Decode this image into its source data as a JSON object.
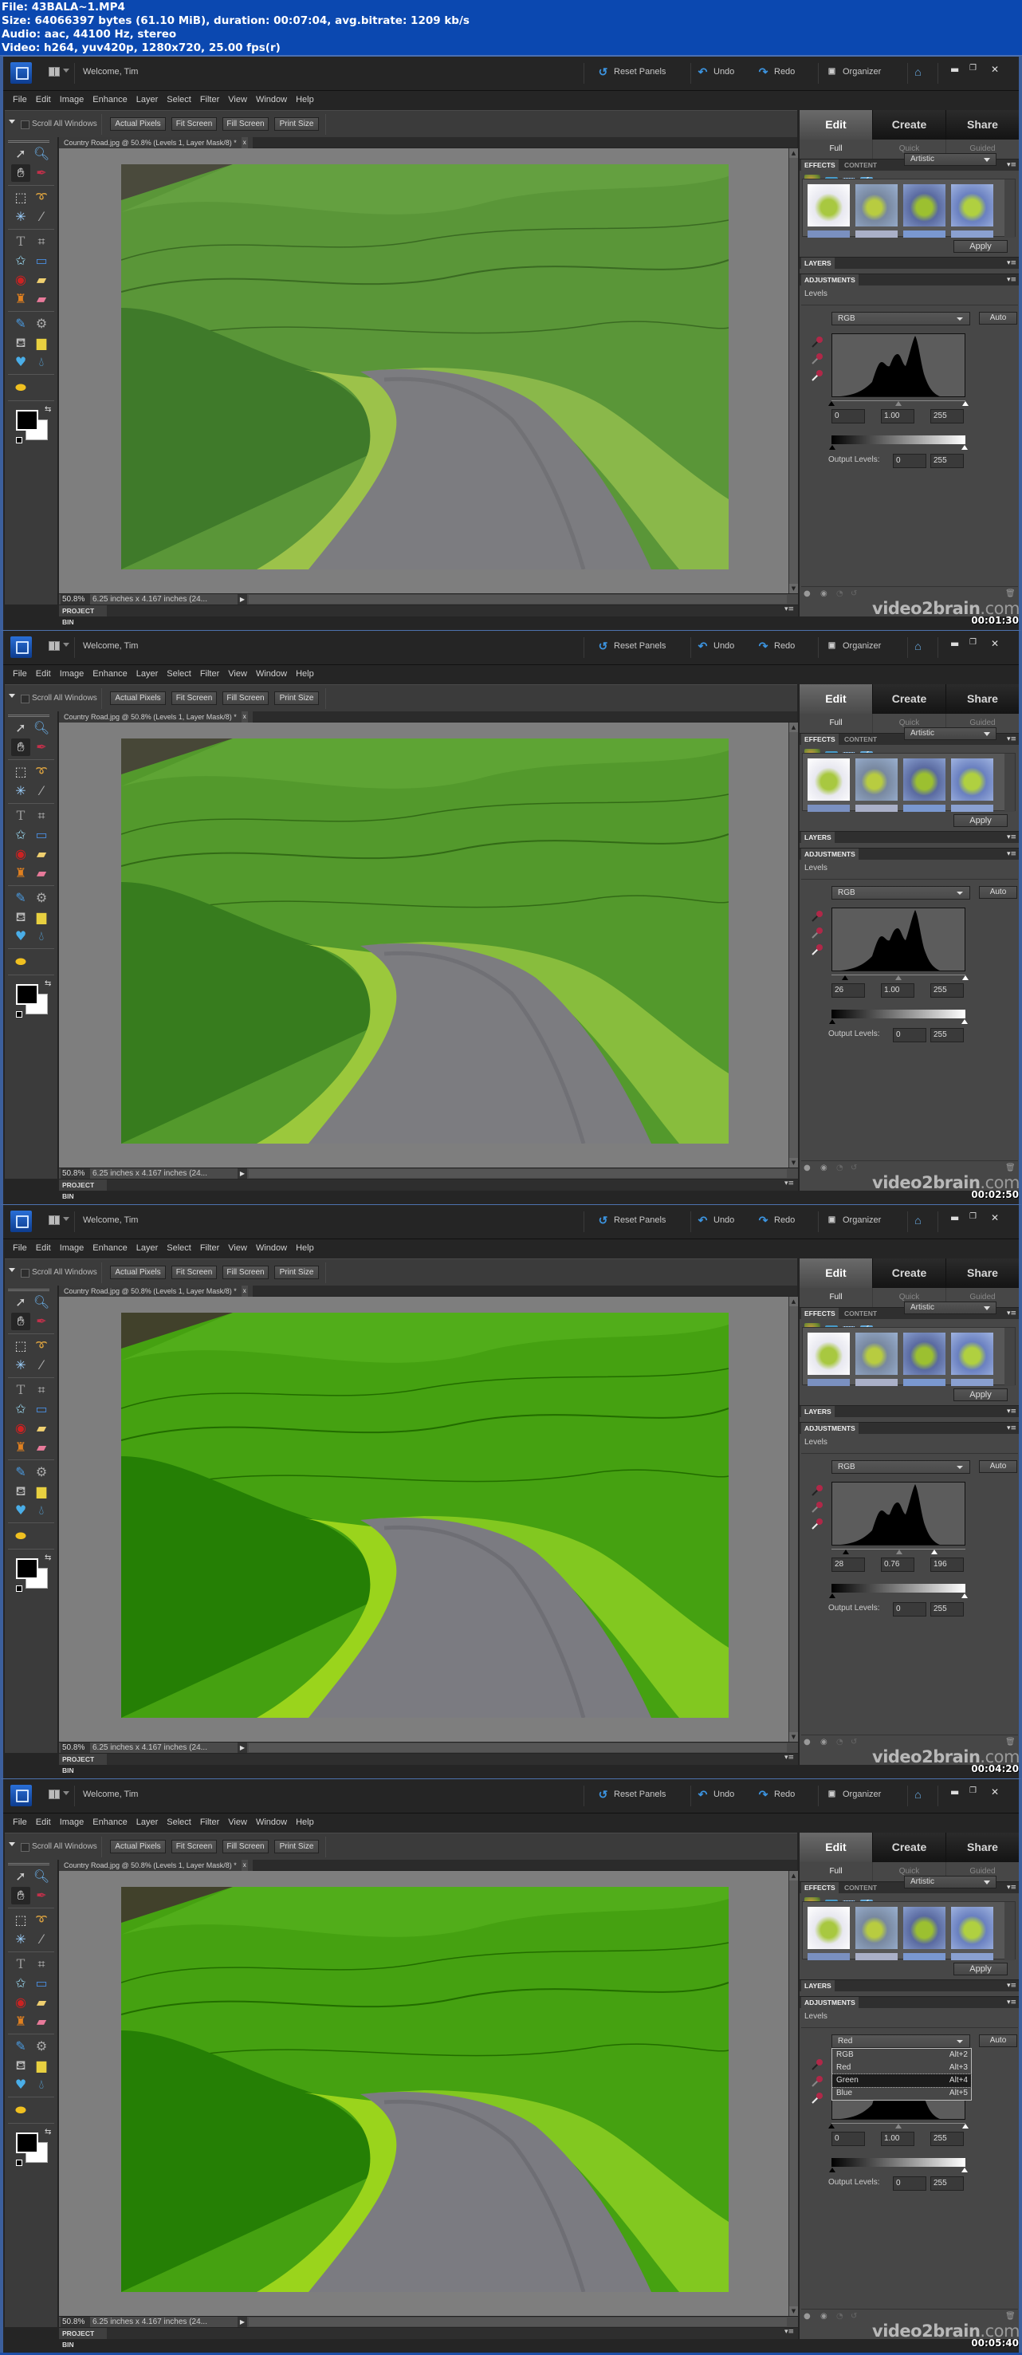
{
  "file_info": {
    "line1": "File: 43BALA~1.MP4",
    "line2": "Size: 64066397 bytes (61.10 MiB), duration: 00:07:04, avg.bitrate: 1209 kb/s",
    "line3": "Audio: aac, 44100 Hz, stereo",
    "line4": "Video: h264, yuv420p, 1280x720, 25.00 fps(r)"
  },
  "app": {
    "welcome": "Welcome, Tim",
    "actions": {
      "reset_panels": "Reset Panels",
      "undo": "Undo",
      "redo": "Redo",
      "organizer": "Organizer"
    },
    "menu": [
      "File",
      "Edit",
      "Image",
      "Enhance",
      "Layer",
      "Select",
      "Filter",
      "View",
      "Window",
      "Help"
    ],
    "options": {
      "scroll_all_windows": "Scroll All Windows",
      "actual_pixels": "Actual Pixels",
      "fit_screen": "Fit Screen",
      "fill_screen": "Fill Screen",
      "print_size": "Print Size"
    },
    "document": {
      "tab_title": "Country Road.jpg @ 50.8% (Levels 1, Layer Mask/8) *",
      "close": "x",
      "zoom": "50.8%",
      "info": "6.25 inches x 4.167 inches (24...",
      "project_bin": "PROJECT BIN"
    },
    "panel": {
      "mode_tabs": [
        "Edit",
        "Create",
        "Share"
      ],
      "sub_tabs": [
        "Full",
        "Quick",
        "Guided"
      ],
      "effects_tab": "EFFECTS",
      "content_tab": "CONTENT",
      "effects_category": "Artistic",
      "apply": "Apply",
      "layers": "LAYERS",
      "adjustments": "ADJUSTMENTS",
      "levels_title": "Levels",
      "auto": "Auto",
      "output_levels_label": "Output Levels:",
      "channel_options": [
        {
          "label": "RGB",
          "shortcut": "Alt+2"
        },
        {
          "label": "Red",
          "shortcut": "Alt+3"
        },
        {
          "label": "Green",
          "shortcut": "Alt+4"
        },
        {
          "label": "Blue",
          "shortcut": "Alt+5"
        }
      ]
    },
    "watermark_main": "video2brain",
    "watermark_suffix": ".com"
  },
  "frames": [
    {
      "timestamp": "00:01:30",
      "channel": "RGB",
      "input_black": "0",
      "input_gamma": "1.00",
      "input_white": "255",
      "output_black": "0",
      "output_white": "255",
      "black_point": 0,
      "gamma": 1.0,
      "white_point": 255,
      "menu_open": false,
      "photo_saturation": 1.0
    },
    {
      "timestamp": "00:02:50",
      "channel": "RGB",
      "input_black": "26",
      "input_gamma": "1.00",
      "input_white": "255",
      "output_black": "0",
      "output_white": "255",
      "black_point": 26,
      "gamma": 1.0,
      "white_point": 255,
      "menu_open": false,
      "photo_saturation": 1.1
    },
    {
      "timestamp": "00:04:20",
      "channel": "RGB",
      "input_black": "28",
      "input_gamma": "0.76",
      "input_white": "196",
      "output_black": "0",
      "output_white": "255",
      "black_point": 28,
      "gamma": 0.76,
      "white_point": 196,
      "menu_open": false,
      "photo_saturation": 1.3
    },
    {
      "timestamp": "00:05:40",
      "channel": "Red",
      "input_black": "0",
      "input_gamma": "1.00",
      "input_white": "255",
      "output_black": "0",
      "output_white": "255",
      "black_point": 0,
      "gamma": 1.0,
      "white_point": 255,
      "menu_open": true,
      "menu_hover": "Green",
      "photo_saturation": 1.3
    }
  ]
}
